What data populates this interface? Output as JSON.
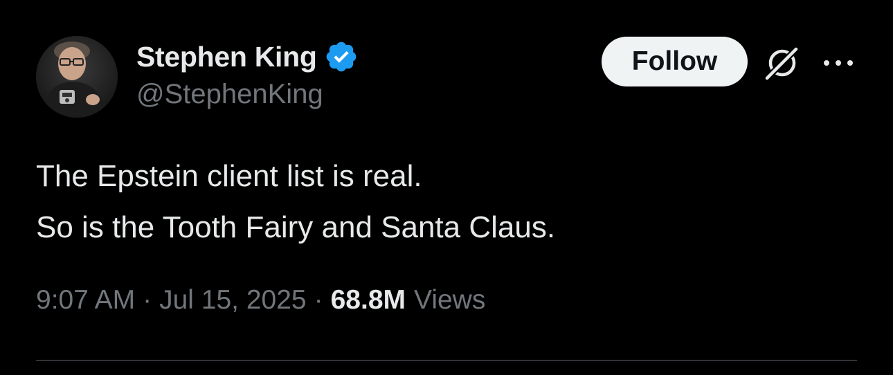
{
  "author": {
    "display_name": "Stephen King",
    "handle": "@StephenKing",
    "verified": true,
    "avatar_icon": "profile-photo"
  },
  "actions": {
    "follow_label": "Follow",
    "grok_icon": "grok-icon",
    "more_icon": "more-horizontal-icon"
  },
  "tweet": {
    "lines": [
      "The Epstein client list is real.",
      "So is the Tooth Fairy and Santa Claus."
    ]
  },
  "meta": {
    "time": "9:07 AM",
    "separator": "·",
    "date": "Jul 15, 2025",
    "views_count": "68.8M",
    "views_label": "Views"
  },
  "colors": {
    "background": "#000000",
    "primary_text": "#e7e9ea",
    "secondary_text": "#71767b",
    "verified_blue": "#1d9bf0",
    "follow_bg": "#eff3f4",
    "divider": "#2f3336"
  }
}
